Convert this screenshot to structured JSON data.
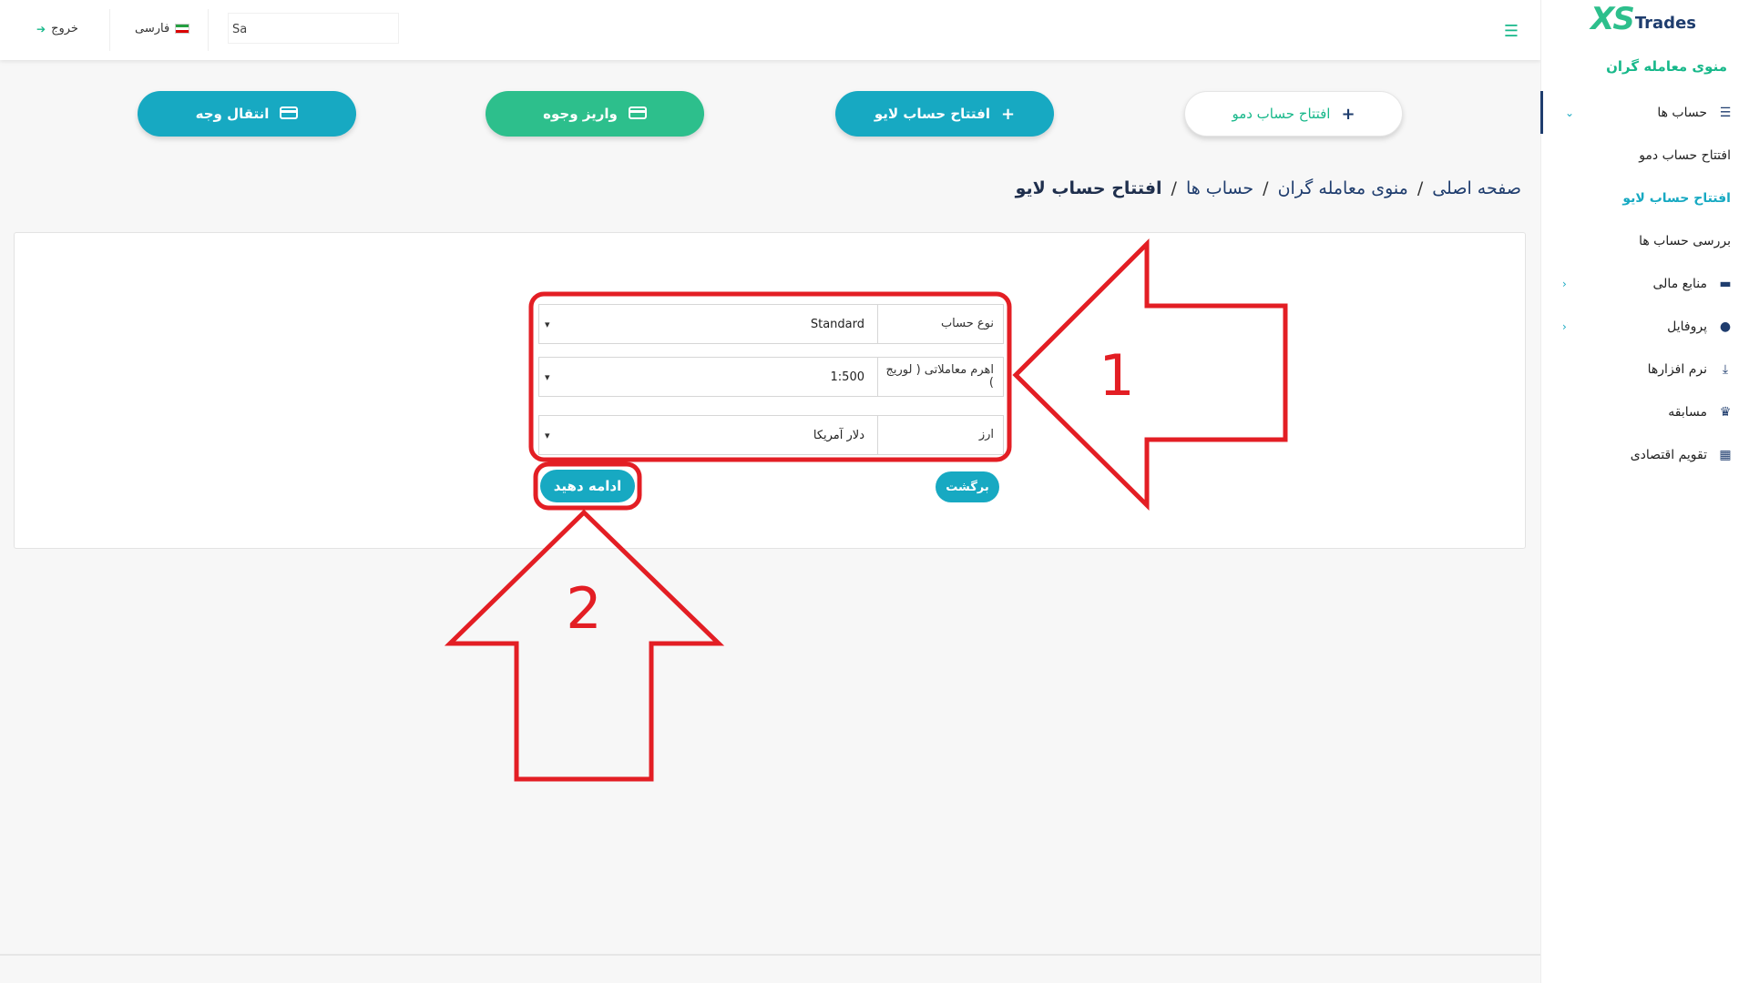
{
  "brand": {
    "logo_xs": "XS",
    "logo_trades": "Trades",
    "primary": "#17b88a",
    "accent": "#17a9c2",
    "navy": "#1f3d6e"
  },
  "sidebar": {
    "title": "منوی معامله گران",
    "items": [
      {
        "label": "حساب ها",
        "icon": "list-icon",
        "chevron": "chevron-down-icon"
      },
      {
        "label": "افتتاح حساب دمو"
      },
      {
        "label": "افتتاح حساب لایو"
      },
      {
        "label": "بررسی حساب ها"
      },
      {
        "label": "منابع مالی",
        "icon": "wallet-icon",
        "chevron": "chevron-left-icon"
      },
      {
        "label": "پروفایل",
        "icon": "user-icon",
        "chevron": "chevron-left-icon"
      },
      {
        "label": "نرم افزارها",
        "icon": "download-icon"
      },
      {
        "label": "مسابقه",
        "icon": "trophy-icon"
      },
      {
        "label": "تقویم اقتصادی",
        "icon": "calendar-icon"
      }
    ]
  },
  "topbar": {
    "user_value": "Sa",
    "language": "فارسی",
    "logout": "خروج"
  },
  "actions": {
    "demo": "افتتاح حساب دمو",
    "live": "افتتاح حساب لایو",
    "deposit": "واریز وجوه",
    "transfer": "انتقال وجه"
  },
  "breadcrumb": [
    "صفحه اصلی",
    "منوی معامله گران",
    "حساب ها",
    "افتتاح حساب لایو"
  ],
  "form": {
    "account_type": {
      "label": "نوع حساب",
      "value": "Standard"
    },
    "leverage": {
      "label": "اهرم معاملاتی ( لوریج )",
      "value": "1:500"
    },
    "currency": {
      "label": "ارز",
      "value": "دلار آمریکا"
    },
    "back": "برگشت",
    "continue": "ادامه دهید"
  },
  "annotations": {
    "label1": "1",
    "label2": "2",
    "color": "#e31e24"
  }
}
